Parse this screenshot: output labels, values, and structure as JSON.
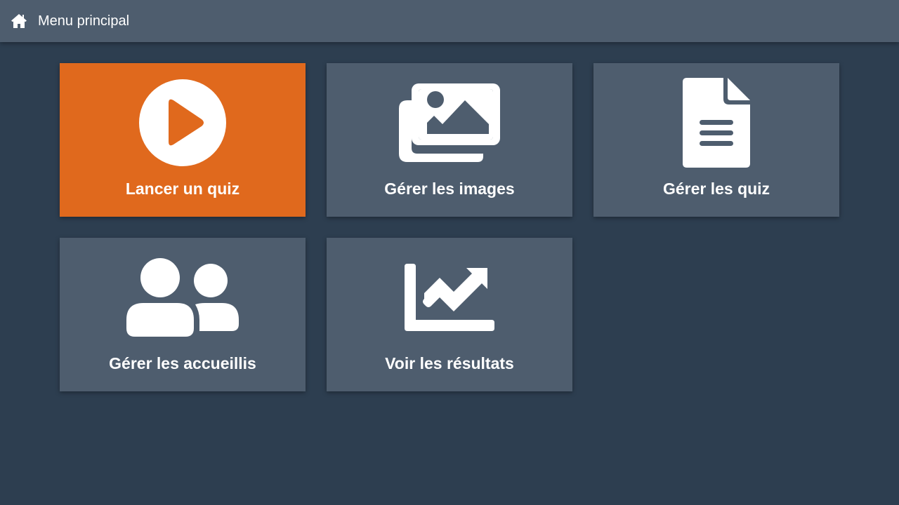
{
  "header": {
    "title": "Menu principal",
    "icon": "home-icon"
  },
  "tiles": [
    {
      "label": "Lancer un quiz",
      "icon": "play-circle-icon",
      "active": true
    },
    {
      "label": "Gérer les images",
      "icon": "images-icon",
      "active": false
    },
    {
      "label": "Gérer les quiz",
      "icon": "document-icon",
      "active": false
    },
    {
      "label": "Gérer les accueillis",
      "icon": "users-icon",
      "active": false
    },
    {
      "label": "Voir les résultats",
      "icon": "chart-line-icon",
      "active": false
    }
  ],
  "colors": {
    "background": "#2d3e50",
    "tile": "#4e5d6e",
    "accent": "#e0691d",
    "text": "#ffffff"
  }
}
